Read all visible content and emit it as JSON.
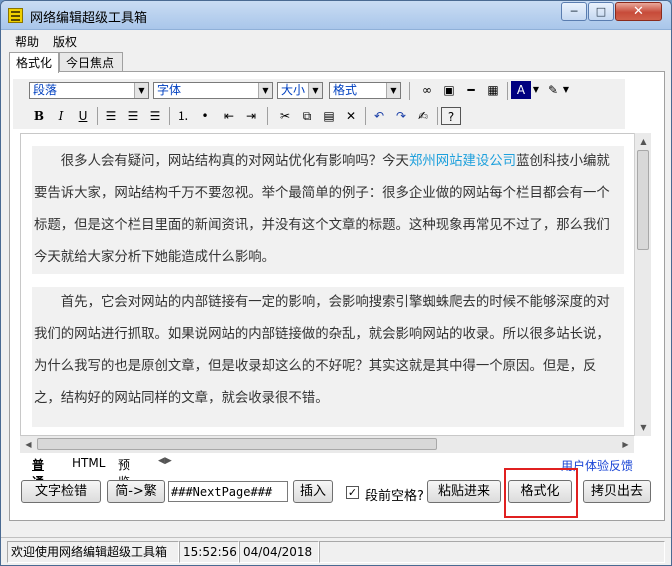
{
  "window": {
    "title": "网络编辑超级工具箱",
    "min": "─",
    "max": "□",
    "close": "✕"
  },
  "menu": [
    "帮助",
    "版权"
  ],
  "tabs": [
    "格式化",
    "今日焦点"
  ],
  "toolbar": {
    "paragraph_select": "段落",
    "font_select": "字体",
    "size_select": "大小",
    "format_select": "格式",
    "bold": "B",
    "italic": "I",
    "underline": "U"
  },
  "editor": {
    "para1_before": "很多人会有疑问，网站结构真的对网站优化有影响吗？今天",
    "para1_link": "郑州网站建设公司",
    "para1_after": "蓝创科技小编就要告诉大家，网站结构千万不要忽视。举个最简单的例子：很多企业做的网站每个栏目都会有一个标题，但是这个栏目里面的新闻资讯，并没有这个文章的标题。这种现象再常见不过了，那么我们今天就给大家分析下她能造成什么影响。",
    "para2": "首先，它会对网站的内部链接有一定的影响，会影响搜索引擎蜘蛛爬去的时候不能够深度的对我们的网站进行抓取。如果说网站的内部链接做的杂乱，就会影响网站的收录。所以很多站长说，为什么我写的也是原创文章，但是收录却这么的不好呢？其实这就是其中得一个原因。但是，反之，结构好的网站同样的文章，就会收录很不错。"
  },
  "bottom_tabs": [
    "普通",
    "HTML",
    "预览"
  ],
  "feedback_link": "用户体验反馈",
  "actions": {
    "spellcheck": "文字检错",
    "simp_trad": "简->繁",
    "nextpage_value": "###NextPage###",
    "insert": "插入",
    "space_label": "段前空格?",
    "paste": "粘贴进来",
    "format": "格式化",
    "copy_out": "拷贝出去"
  },
  "status": {
    "welcome": "欢迎使用网络编辑超级工具箱",
    "time": "15:52:56",
    "date": "04/04/2018"
  }
}
